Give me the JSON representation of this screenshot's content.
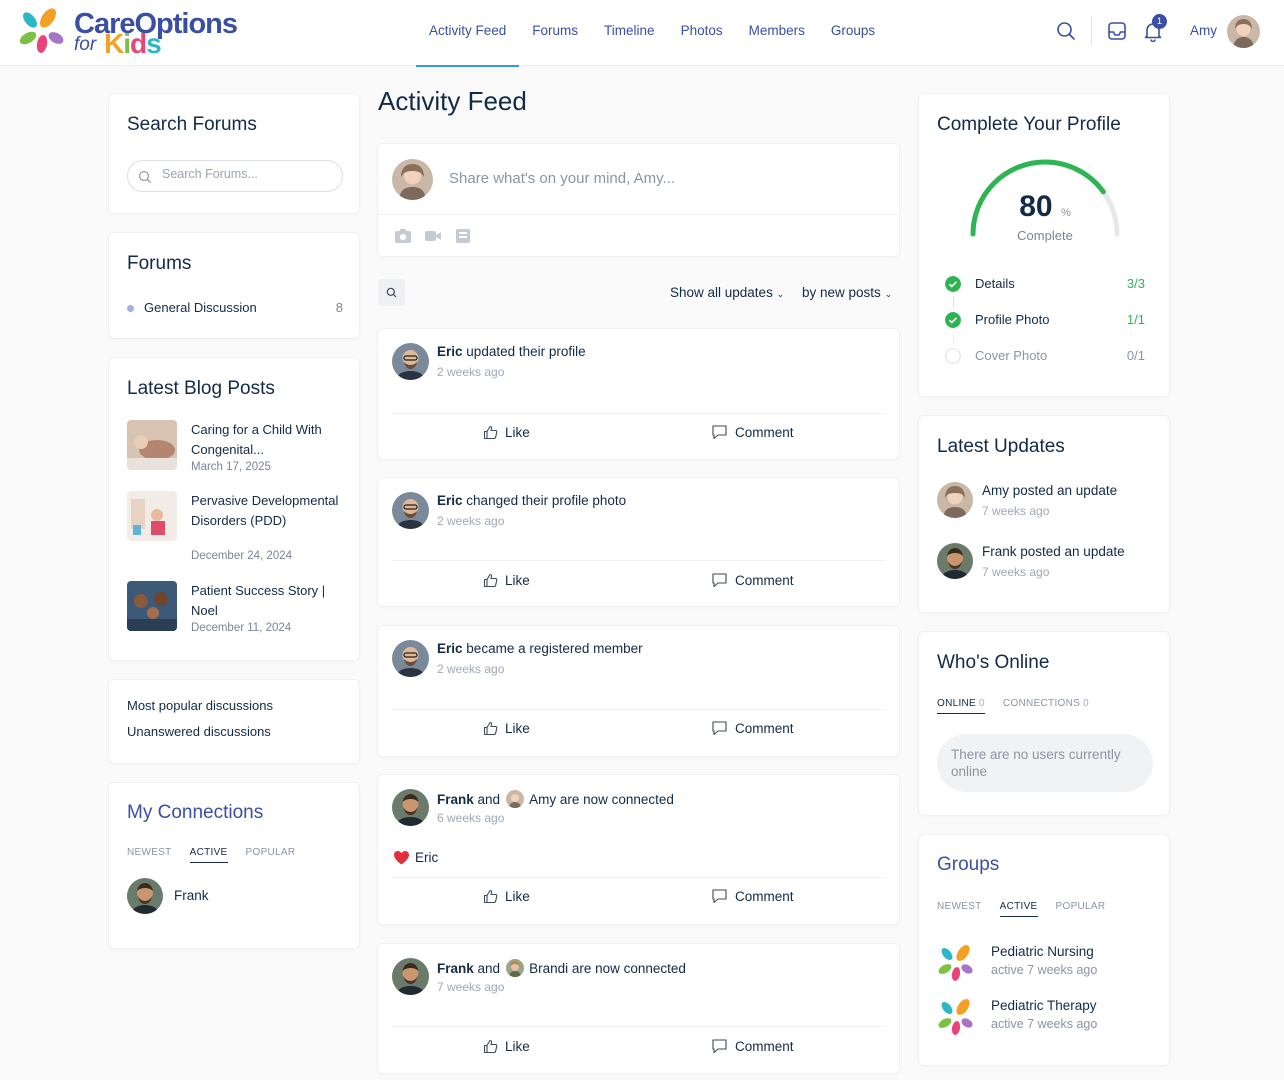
{
  "brand": {
    "line1": "CareOptions",
    "line2": "for",
    "kids_letters": [
      "K",
      "i",
      "d",
      "s"
    ]
  },
  "nav": {
    "items": [
      "Activity Feed",
      "Forums",
      "Timeline",
      "Photos",
      "Members",
      "Groups"
    ],
    "active": "Activity Feed"
  },
  "header": {
    "notification_count": "1",
    "user_name": "Amy",
    "icons": [
      "search-icon",
      "inbox-icon",
      "bell-icon"
    ]
  },
  "left": {
    "search_forums": {
      "title": "Search Forums",
      "placeholder": "Search Forums..."
    },
    "forums": {
      "title": "Forums",
      "items": [
        {
          "name": "General Discussion",
          "count": "8"
        }
      ]
    },
    "blog": {
      "title": "Latest Blog Posts",
      "posts": [
        {
          "title": "Caring for a Child With Congenital...",
          "date": "March 17, 2025"
        },
        {
          "title": "Pervasive Developmental Disorders (PDD)",
          "date": "December 24, 2024"
        },
        {
          "title": "Patient Success Story | Noel",
          "date": "December 11, 2024"
        }
      ]
    },
    "discussions": {
      "links": [
        "Most popular discussions",
        "Unanswered discussions"
      ]
    },
    "connections": {
      "title": "My Connections",
      "tabs": [
        "NEWEST",
        "ACTIVE",
        "POPULAR"
      ],
      "active_tab": "ACTIVE",
      "members": [
        {
          "name": "Frank"
        }
      ]
    }
  },
  "main": {
    "title": "Activity Feed",
    "composer_placeholder": "Share what's on your mind, Amy...",
    "filters": {
      "show": "Show all updates",
      "order": "by new posts"
    },
    "like_label": "Like",
    "comment_label": "Comment",
    "activities": [
      {
        "actor": "Eric",
        "action": "updated their profile",
        "time": "2 weeks ago"
      },
      {
        "actor": "Eric",
        "action": "changed their profile photo",
        "time": "2 weeks ago"
      },
      {
        "actor": "Eric",
        "action": "became a registered member",
        "time": "2 weeks ago"
      },
      {
        "actor": "Frank",
        "and": "and",
        "other": "Amy",
        "action": "are now connected",
        "time": "6 weeks ago",
        "reaction": "Eric"
      },
      {
        "actor": "Frank",
        "and": "and",
        "other": "Brandi",
        "action": "are now connected",
        "time": "7 weeks ago"
      }
    ]
  },
  "right": {
    "profile": {
      "title": "Complete Your Profile",
      "percent": 80,
      "percent_label": "80",
      "percent_sign": "%",
      "complete_label": "Complete",
      "steps": [
        {
          "label": "Details",
          "value": "3/3",
          "done": true
        },
        {
          "label": "Profile Photo",
          "value": "1/1",
          "done": true
        },
        {
          "label": "Cover Photo",
          "value": "0/1",
          "done": false
        }
      ]
    },
    "updates": {
      "title": "Latest Updates",
      "items": [
        {
          "text": "Amy posted an update",
          "time": "7 weeks ago"
        },
        {
          "text": "Frank posted an update",
          "time": "7 weeks ago"
        }
      ]
    },
    "online": {
      "title": "Who's Online",
      "tabs": [
        {
          "label": "ONLINE",
          "count": "0"
        },
        {
          "label": "CONNECTIONS",
          "count": "0"
        }
      ],
      "empty": "There are no users currently online"
    },
    "groups": {
      "title": "Groups",
      "tabs": [
        "NEWEST",
        "ACTIVE",
        "POPULAR"
      ],
      "active_tab": "ACTIVE",
      "items": [
        {
          "name": "Pediatric Nursing",
          "time": "active 7 weeks ago"
        },
        {
          "name": "Pediatric Therapy",
          "time": "active 7 weeks ago"
        }
      ]
    }
  },
  "colors": {
    "accent": "#3a4fa3",
    "success": "#2fb454",
    "heart": "#e0303f"
  }
}
